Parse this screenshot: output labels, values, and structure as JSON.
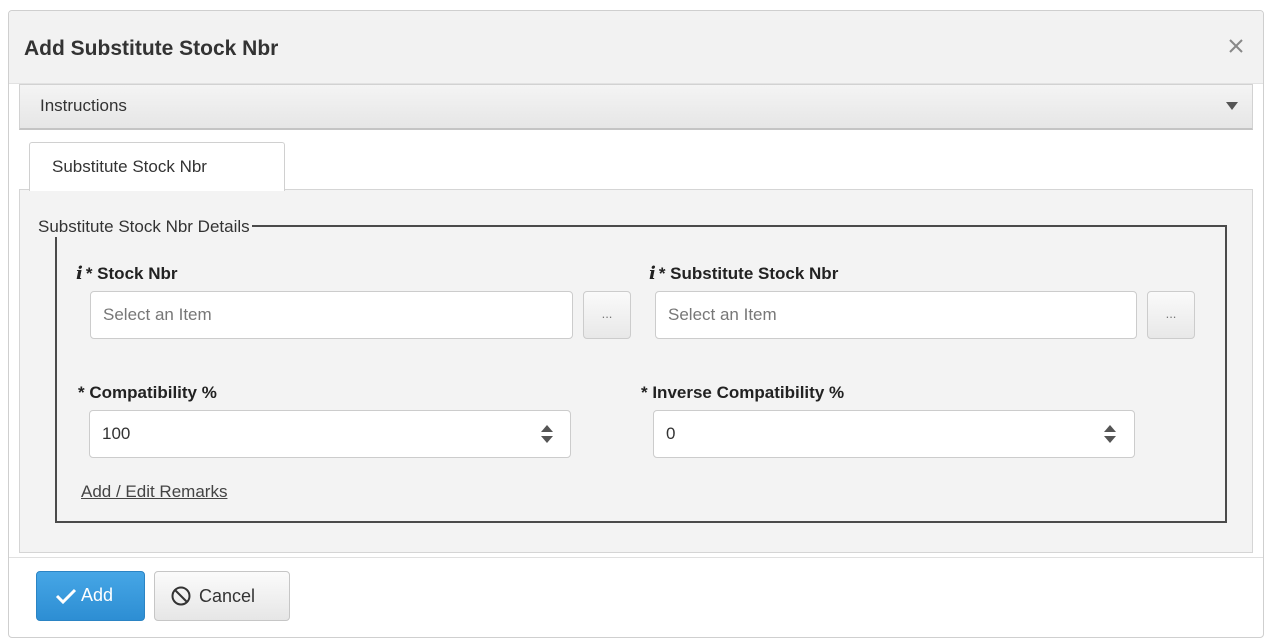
{
  "dialog": {
    "title": "Add Substitute Stock Nbr",
    "close_icon": "close-x-icon"
  },
  "instructions": {
    "label": "Instructions",
    "toggle_icon": "caret-down-icon"
  },
  "tabs": [
    {
      "label": "Substitute Stock Nbr"
    }
  ],
  "details": {
    "legend": "Substitute Stock Nbr Details",
    "stock_nbr": {
      "label": "* Stock Nbr",
      "info_icon": "i",
      "placeholder": "Select an Item",
      "value": "",
      "lookup_label": "..."
    },
    "substitute_stock_nbr": {
      "label": "* Substitute Stock Nbr",
      "info_icon": "i",
      "placeholder": "Select an Item",
      "value": "",
      "lookup_label": "..."
    },
    "compatibility": {
      "label": "* Compatibility %",
      "value": "100"
    },
    "inverse_compatibility": {
      "label": "* Inverse Compatibility %",
      "value": "0"
    },
    "remarks_link": "Add / Edit Remarks"
  },
  "footer": {
    "add_label": "Add",
    "cancel_label": "Cancel"
  },
  "colors": {
    "primary": "#2d8ed3",
    "border": "#4a4a4a",
    "panel": "#f3f3f3"
  }
}
